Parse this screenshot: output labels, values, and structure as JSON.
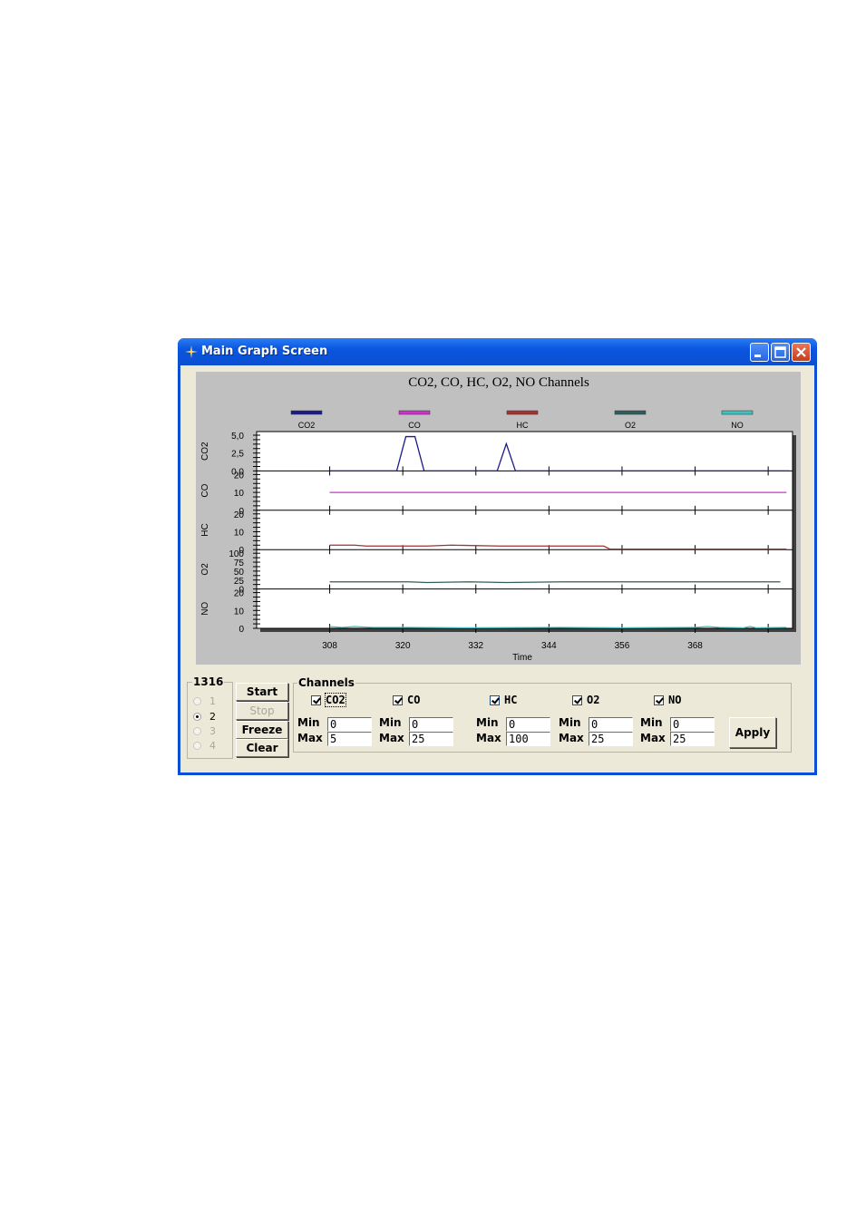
{
  "window": {
    "title": "Main Graph Screen",
    "controls": [
      "minimize-icon",
      "maximize-icon",
      "close-icon"
    ]
  },
  "chart_data": {
    "type": "line",
    "title": "CO2, CO, HC, O2, NO Channels",
    "xlabel": "Time",
    "xlim": [
      290,
      378
    ],
    "xticks": [
      308,
      320,
      332,
      344,
      356,
      368
    ],
    "legend_placement": "top",
    "grid": false,
    "series": [
      {
        "name": "CO2",
        "color": "#1a1a8c",
        "ylabel": "CO2",
        "ylim": [
          0,
          5
        ],
        "yticks": [
          "5,0",
          "2,5",
          "0,0"
        ],
        "x": [
          294,
          302,
          304,
          305,
          306,
          307,
          308,
          310,
          313,
          314,
          315,
          318,
          329,
          330,
          331,
          332,
          333,
          340,
          352,
          365,
          377
        ],
        "y": [
          0,
          0,
          0,
          0,
          0,
          0,
          0,
          0,
          0,
          0,
          0,
          0,
          0,
          0,
          0,
          0,
          0,
          0,
          0,
          0,
          0
        ],
        "peaks": [
          {
            "x": [
              313,
              314.5,
              316,
              317.5
            ],
            "y": [
              0,
              4.8,
              4.8,
              0
            ]
          },
          {
            "x": [
              329.5,
              331,
              332.5
            ],
            "y": [
              0,
              3.8,
              0
            ]
          }
        ]
      },
      {
        "name": "CO",
        "color": "#cc33cc",
        "ylabel": "CO",
        "ylim": [
          0,
          20
        ],
        "yticks": [
          "20",
          "10",
          "0"
        ],
        "x": [
          302,
          377
        ],
        "y": [
          10,
          10
        ]
      },
      {
        "name": "HC",
        "color": "#a83232",
        "ylabel": "HC",
        "ylim": [
          0,
          20
        ],
        "yticks": [
          "20",
          "10",
          "0"
        ],
        "x": [
          302,
          306,
          308,
          318,
          322,
          330,
          340,
          347,
          348,
          377
        ],
        "y": [
          2.5,
          2.5,
          2,
          2,
          2.5,
          2,
          2,
          2,
          0.3,
          0.3
        ]
      },
      {
        "name": "O2",
        "color": "#2f5f5a",
        "ylabel": "O2",
        "ylim": [
          0,
          100
        ],
        "yticks": [
          "100",
          "75",
          "50",
          "25",
          "0"
        ],
        "x": [
          302,
          307,
          315,
          318,
          325,
          331,
          340,
          376
        ],
        "y": [
          20,
          20,
          20,
          18,
          20,
          18,
          20,
          20
        ]
      },
      {
        "name": "NO",
        "color": "#40c0c0",
        "ylabel": "NO",
        "ylim": [
          0,
          20
        ],
        "yticks": [
          "20",
          "10",
          "0"
        ],
        "x": [
          302,
          304,
          306,
          309,
          315,
          325,
          340,
          350,
          362,
          364,
          366,
          370,
          371,
          372,
          377
        ],
        "y": [
          1,
          0.5,
          1,
          0.5,
          0.5,
          0.3,
          0.5,
          0.3,
          0.5,
          1,
          0.5,
          0.3,
          1,
          0.3,
          0.5
        ]
      }
    ]
  },
  "device": {
    "group_label": "1316",
    "radios": [
      {
        "label": "1",
        "selected": false,
        "enabled": false
      },
      {
        "label": "2",
        "selected": true,
        "enabled": true
      },
      {
        "label": "3",
        "selected": false,
        "enabled": false
      },
      {
        "label": "4",
        "selected": false,
        "enabled": false
      }
    ]
  },
  "buttons": {
    "start": "Start",
    "stop": "Stop",
    "freeze": "Freeze",
    "clear": "Clear",
    "apply": "Apply"
  },
  "channels": {
    "group_label": "Channels",
    "min_label": "Min",
    "max_label": "Max",
    "items": [
      {
        "name": "CO2",
        "checked": true,
        "min": "0",
        "max": "5"
      },
      {
        "name": "CO",
        "checked": true,
        "min": "0",
        "max": "25"
      },
      {
        "name": "HC",
        "checked": true,
        "min": "0",
        "max": "100"
      },
      {
        "name": "O2",
        "checked": true,
        "min": "0",
        "max": "25"
      },
      {
        "name": "NO",
        "checked": true,
        "min": "0",
        "max": "25"
      }
    ]
  }
}
